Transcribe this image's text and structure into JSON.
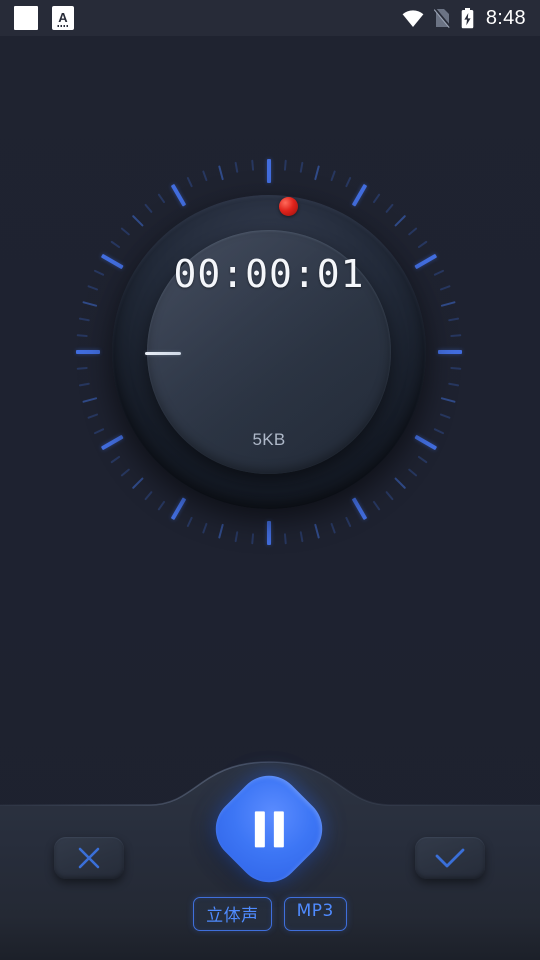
{
  "status_bar": {
    "time": "8:48",
    "left_icons": [
      {
        "name": "app-square-icon",
        "label": ""
      },
      {
        "name": "keyboard-ime-icon",
        "label": "A"
      }
    ],
    "right_icons": [
      {
        "name": "wifi-icon"
      },
      {
        "name": "no-sim-icon"
      },
      {
        "name": "battery-charging-icon"
      }
    ]
  },
  "recorder": {
    "elapsed_time": "00:00:01",
    "file_size": "5KB",
    "recording_indicator": "recording",
    "dial_tick_count": 72
  },
  "controls": {
    "cancel_label": "",
    "confirm_label": "",
    "pause_label": "",
    "tags": [
      {
        "label": "立体声",
        "name": "tag-stereo"
      },
      {
        "label": "MP3",
        "name": "tag-format"
      }
    ]
  },
  "colors": {
    "background": "#1e2230",
    "bottom_bar": "#262b38",
    "accent_blue": "#3d76f5",
    "tick_blue": "#3a63cc",
    "record_red": "#e0231c",
    "text_primary": "#f4f6fa",
    "text_secondary": "#aeb8c8"
  }
}
